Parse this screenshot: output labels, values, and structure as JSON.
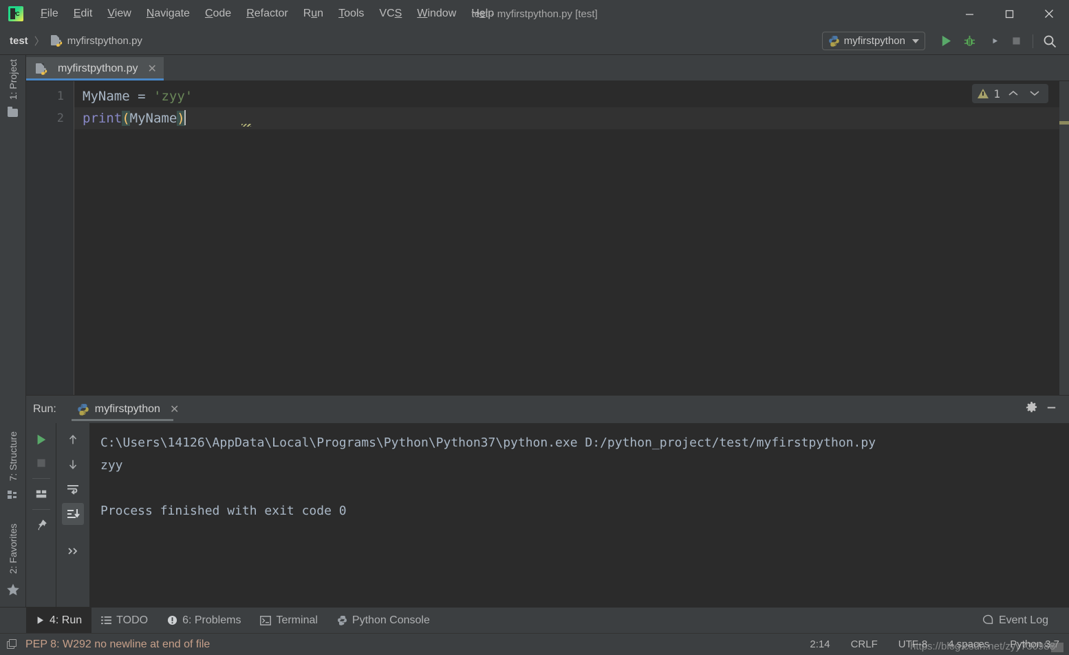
{
  "window": {
    "title": "test - myfirstpython.py [test]",
    "logo_text": "PC",
    "minimize_icon": "–",
    "maximize_icon": "☐",
    "close_icon": "✕"
  },
  "menubar": {
    "items": [
      {
        "name": "file",
        "label": "File",
        "mnemonic": "F"
      },
      {
        "name": "edit",
        "label": "Edit",
        "mnemonic": "E"
      },
      {
        "name": "view",
        "label": "View",
        "mnemonic": "V"
      },
      {
        "name": "navigate",
        "label": "Navigate",
        "mnemonic": "N"
      },
      {
        "name": "code",
        "label": "Code",
        "mnemonic": "C"
      },
      {
        "name": "refactor",
        "label": "Refactor",
        "mnemonic": "R"
      },
      {
        "name": "run",
        "label": "Run",
        "mnemonic": "u"
      },
      {
        "name": "tools",
        "label": "Tools",
        "mnemonic": "T"
      },
      {
        "name": "vcs",
        "label": "VCS",
        "mnemonic": "S"
      },
      {
        "name": "window",
        "label": "Window",
        "mnemonic": "W"
      },
      {
        "name": "help",
        "label": "Help",
        "mnemonic": "H"
      }
    ]
  },
  "navbar": {
    "breadcrumb": {
      "project": "test",
      "separator": "〉",
      "file": "myfirstpython.py"
    },
    "run_config": {
      "name": "myfirstpython",
      "icon": "python-icon",
      "dropdown_icon": "chevron-down-icon"
    },
    "buttons": [
      {
        "name": "run-button",
        "icon": "play-icon",
        "color": "#59a869"
      },
      {
        "name": "debug-button",
        "icon": "bug-icon",
        "color": "#56a056"
      },
      {
        "name": "run-with-coverage-button",
        "icon": "coverage-icon",
        "color": "#9aa0a6"
      },
      {
        "name": "stop-button",
        "icon": "stop-square-icon",
        "color": "#6e7173"
      },
      {
        "name": "search-everywhere-button",
        "icon": "search-icon",
        "color": "#c0c0c0"
      }
    ]
  },
  "left_strip": {
    "project": {
      "label": "1: Project",
      "mnemonic": "1",
      "icon": "folder-icon"
    },
    "structure": {
      "label": "7: Structure",
      "mnemonic": "7",
      "icon": "structure-icon"
    },
    "favorites": {
      "label": "2: Favorites",
      "mnemonic": "2",
      "icon": "star-icon"
    }
  },
  "editor": {
    "tab": {
      "label": "myfirstpython.py",
      "close_icon": "✕",
      "icon": "python-file-icon"
    },
    "line_numbers": [
      "1",
      "2"
    ],
    "code": {
      "line1": {
        "var": "MyName",
        "space1": " ",
        "eq": "=",
        "space2": " ",
        "string": "'zyy'"
      },
      "line2": {
        "fn": "print",
        "lparen": "(",
        "arg": "MyName",
        "rparen": ")"
      }
    },
    "inspections": {
      "warning_count": "1",
      "warning_icon": "warning-triangle-icon",
      "prev_icon": "chevron-up-icon",
      "next_icon": "chevron-down-icon"
    }
  },
  "run_panel": {
    "header_label": "Run:",
    "tab": {
      "label": "myfirstpython",
      "icon": "python-icon",
      "close_icon": "✕"
    },
    "settings_icon": "gear-icon",
    "minimize_icon": "minimize-icon",
    "toolbar_left": [
      {
        "name": "rerun-button",
        "icon": "play-icon"
      },
      {
        "name": "stop-process-button",
        "icon": "stop-square-icon"
      },
      {
        "name": "layout-button",
        "icon": "layout-icon"
      },
      {
        "name": "pin-tab-button",
        "icon": "pin-icon"
      }
    ],
    "toolbar_right": [
      {
        "name": "up-button",
        "icon": "arrow-up-icon"
      },
      {
        "name": "down-button",
        "icon": "arrow-down-icon"
      },
      {
        "name": "soft-wrap-button",
        "icon": "soft-wrap-icon"
      },
      {
        "name": "scroll-to-end-button",
        "icon": "scroll-to-end-icon"
      },
      {
        "name": "more-options-button",
        "icon": "chevron-double-right-icon"
      }
    ],
    "console": {
      "command": "C:\\Users\\14126\\AppData\\Local\\Programs\\Python\\Python37\\python.exe D:/python_project/test/myfirstpython.py",
      "output": "zyy",
      "blank": "",
      "exit_message": "Process finished with exit code 0"
    }
  },
  "bottom_bar": {
    "tabs": [
      {
        "name": "run",
        "label": "4: Run",
        "mnemonic": "4",
        "icon": "play-icon",
        "active": true
      },
      {
        "name": "todo",
        "label": "TODO",
        "mnemonic": "",
        "icon": "list-icon",
        "active": false
      },
      {
        "name": "problems",
        "label": "6: Problems",
        "mnemonic": "6",
        "icon": "error-circle-icon",
        "active": false
      },
      {
        "name": "terminal",
        "label": "Terminal",
        "mnemonic": "",
        "icon": "terminal-icon",
        "active": false
      },
      {
        "name": "python-console",
        "label": "Python Console",
        "mnemonic": "",
        "icon": "python-icon",
        "active": false
      }
    ],
    "event_log": {
      "label": "Event Log",
      "icon": "balloon-icon"
    }
  },
  "status_bar": {
    "icon": "copy-stack-icon",
    "message": "PEP 8: W292 no newline at end of file",
    "caret_position": "2:14",
    "line_separator": "CRLF",
    "encoding": "UTF-8",
    "indent": "4 spaces",
    "interpreter": "Python 3.7"
  },
  "watermark": {
    "text": "https://blog.csdn.net/zyy730988"
  }
}
